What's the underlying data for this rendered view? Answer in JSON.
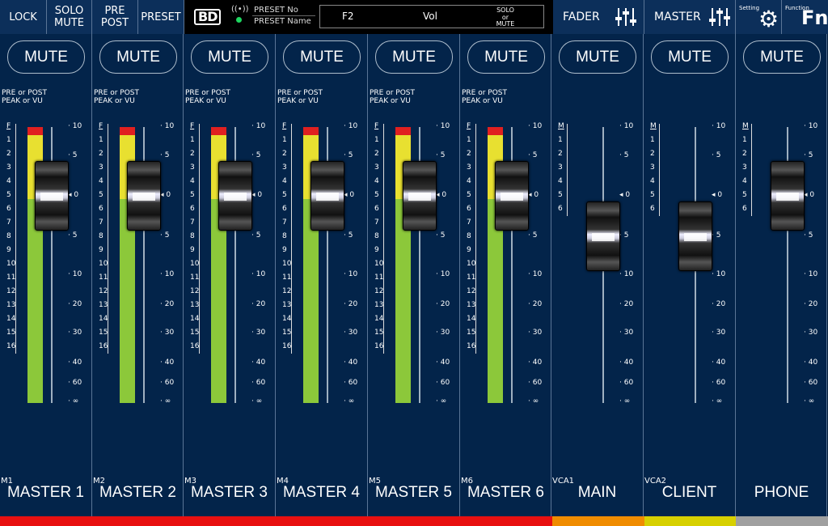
{
  "topbar": {
    "lock": "LOCK",
    "solo_mute": "SOLO\nMUTE",
    "pre_post": "PRE\nPOST",
    "preset": "PRESET",
    "logo": "BD",
    "preset_no": "PRESET No",
    "preset_name": "PRESET Name",
    "param_f2": "F2",
    "param_vol": "Vol",
    "param_solo_mute": "SOLO\nor\nMUTE",
    "fader": "FADER",
    "master": "MASTER",
    "setting": "Setting",
    "function": "Function",
    "fn": "Fn"
  },
  "strip_common": {
    "mute": "MUTE",
    "meter_mode": "PRE or POST\nPEAK or VU",
    "db_labels": [
      "10",
      "5",
      "0",
      "5",
      "10",
      "20",
      "30",
      "40",
      "60",
      "∞"
    ],
    "ch_numbers": [
      "F",
      "1",
      "2",
      "3",
      "4",
      "5",
      "6",
      "7",
      "8",
      "9",
      "10",
      "11",
      "12",
      "13",
      "14",
      "15",
      "16"
    ],
    "vca_numbers": [
      "M",
      "1",
      "2",
      "3",
      "4",
      "5",
      "6"
    ]
  },
  "strips": [
    {
      "id": "M1",
      "name": "MASTER 1",
      "type": "ch",
      "fader_db": 0,
      "meter": true
    },
    {
      "id": "M2",
      "name": "MASTER 2",
      "type": "ch",
      "fader_db": 0,
      "meter": true
    },
    {
      "id": "M3",
      "name": "MASTER 3",
      "type": "ch",
      "fader_db": 0,
      "meter": true
    },
    {
      "id": "M4",
      "name": "MASTER 4",
      "type": "ch",
      "fader_db": 0,
      "meter": true
    },
    {
      "id": "M5",
      "name": "MASTER 5",
      "type": "ch",
      "fader_db": 0,
      "meter": true
    },
    {
      "id": "M6",
      "name": "MASTER 6",
      "type": "ch",
      "fader_db": 0,
      "meter": true
    },
    {
      "id": "VCA1",
      "name": "MAIN",
      "type": "vca",
      "fader_db": -5,
      "meter": false
    },
    {
      "id": "VCA2",
      "name": "CLIENT",
      "type": "vca",
      "fader_db": -5,
      "meter": false
    },
    {
      "id": "",
      "name": "PHONE",
      "type": "vca",
      "fader_db": 0,
      "meter": false
    }
  ],
  "colors": {
    "meter_red": "#e02020",
    "meter_yellow": "#e8e030",
    "meter_green": "#8cc83a",
    "bar_master": "#e81010",
    "bar_vca1": "#f08c00",
    "bar_vca2": "#d7d000",
    "bar_phone": "#a0a0a0"
  }
}
